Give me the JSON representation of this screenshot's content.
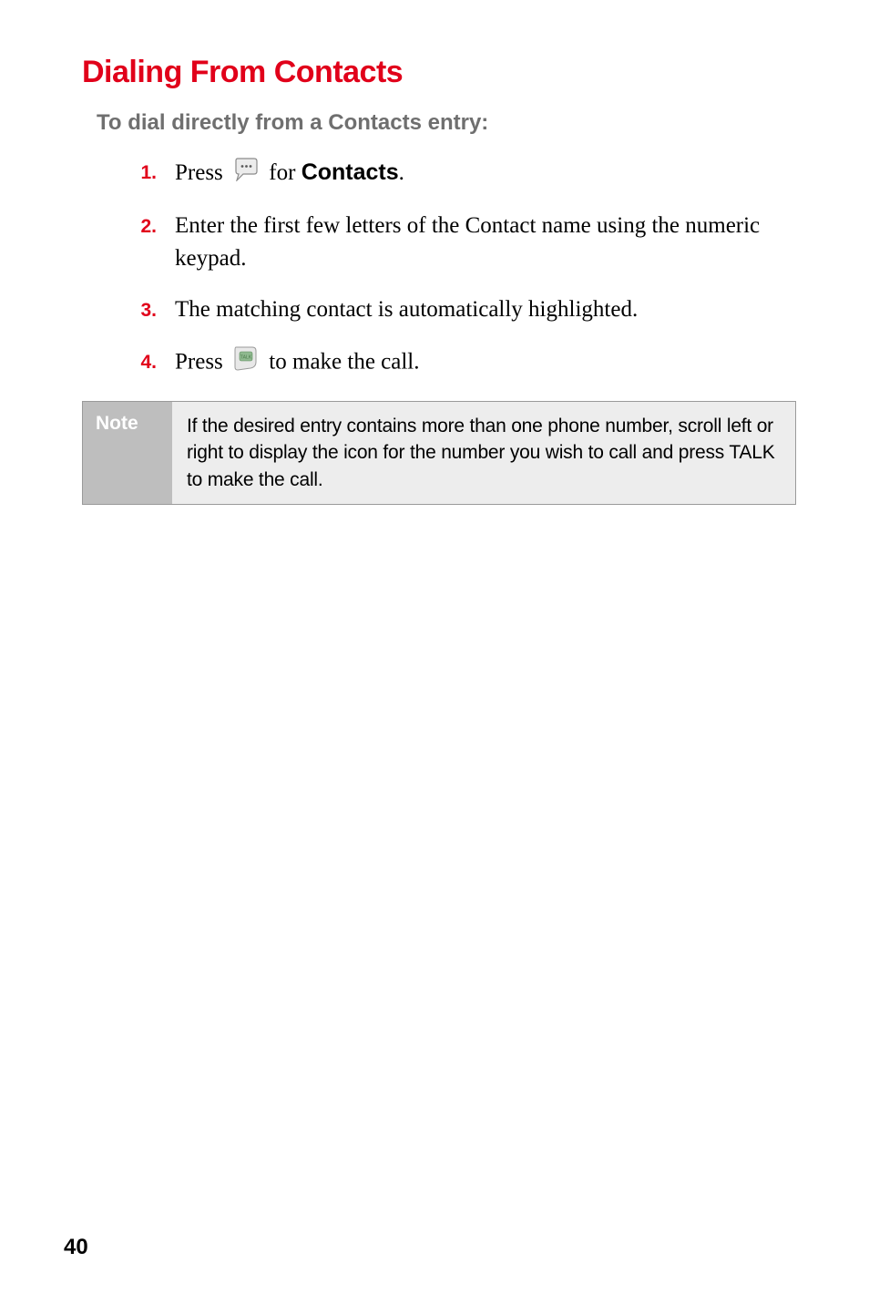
{
  "heading": "Dialing From Contacts",
  "subheading": "To dial directly from a Contacts entry:",
  "steps": {
    "s1": {
      "num": "1.",
      "pre": "Press ",
      "icon": "speech-bubble-icon",
      "post_a": " for ",
      "bold": "Contacts",
      "post_b": "."
    },
    "s2": {
      "num": "2.",
      "text": "Enter the first few letters of the Contact name using the numeric keypad."
    },
    "s3": {
      "num": "3.",
      "text": "The matching contact is automatically highlighted."
    },
    "s4": {
      "num": "4.",
      "pre": "Press ",
      "icon": "talk-key-icon",
      "post": " to make the call."
    }
  },
  "note": {
    "label": "Note",
    "body": "If the desired entry contains more than one phone number, scroll left or right to display the icon for the number you wish to call and press TALK to make the call."
  },
  "page_number": "40"
}
